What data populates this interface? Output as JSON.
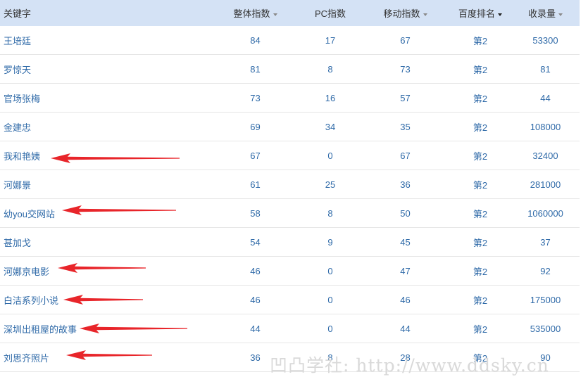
{
  "headers": {
    "keyword": "关键字",
    "total_index": "整体指数",
    "pc_index": "PC指数",
    "mobile_index": "移动指数",
    "baidu_rank": "百度排名",
    "indexed_count": "收录量"
  },
  "rows": [
    {
      "keyword": "王培廷",
      "total": "84",
      "pc": "17",
      "mobile": "67",
      "rank": "第2",
      "count": "53300"
    },
    {
      "keyword": "罗惊天",
      "total": "81",
      "pc": "8",
      "mobile": "73",
      "rank": "第2",
      "count": "81"
    },
    {
      "keyword": "官场张梅",
      "total": "73",
      "pc": "16",
      "mobile": "57",
      "rank": "第2",
      "count": "44"
    },
    {
      "keyword": "金建忠",
      "total": "69",
      "pc": "34",
      "mobile": "35",
      "rank": "第2",
      "count": "108000"
    },
    {
      "keyword": "我和艳姨",
      "total": "67",
      "pc": "0",
      "mobile": "67",
      "rank": "第2",
      "count": "32400"
    },
    {
      "keyword": "河娜景",
      "total": "61",
      "pc": "25",
      "mobile": "36",
      "rank": "第2",
      "count": "281000"
    },
    {
      "keyword": "幼you交网站",
      "total": "58",
      "pc": "8",
      "mobile": "50",
      "rank": "第2",
      "count": "1060000"
    },
    {
      "keyword": "甚加戈",
      "total": "54",
      "pc": "9",
      "mobile": "45",
      "rank": "第2",
      "count": "37"
    },
    {
      "keyword": "河娜京电影",
      "total": "46",
      "pc": "0",
      "mobile": "47",
      "rank": "第2",
      "count": "92"
    },
    {
      "keyword": "白洁系列小说",
      "total": "46",
      "pc": "0",
      "mobile": "46",
      "rank": "第2",
      "count": "175000"
    },
    {
      "keyword": "深圳出租屋的故事",
      "total": "44",
      "pc": "0",
      "mobile": "44",
      "rank": "第2",
      "count": "535000"
    },
    {
      "keyword": "刘思齐照片",
      "total": "36",
      "pc": "8",
      "mobile": "28",
      "rank": "第2",
      "count": "90"
    }
  ],
  "watermark": "凹凸学社: http://www.ddsky.cn",
  "colors": {
    "header_bg": "#d4e2f5",
    "link_text": "#2f6aa8",
    "annotation_arrow": "#e8252a"
  }
}
